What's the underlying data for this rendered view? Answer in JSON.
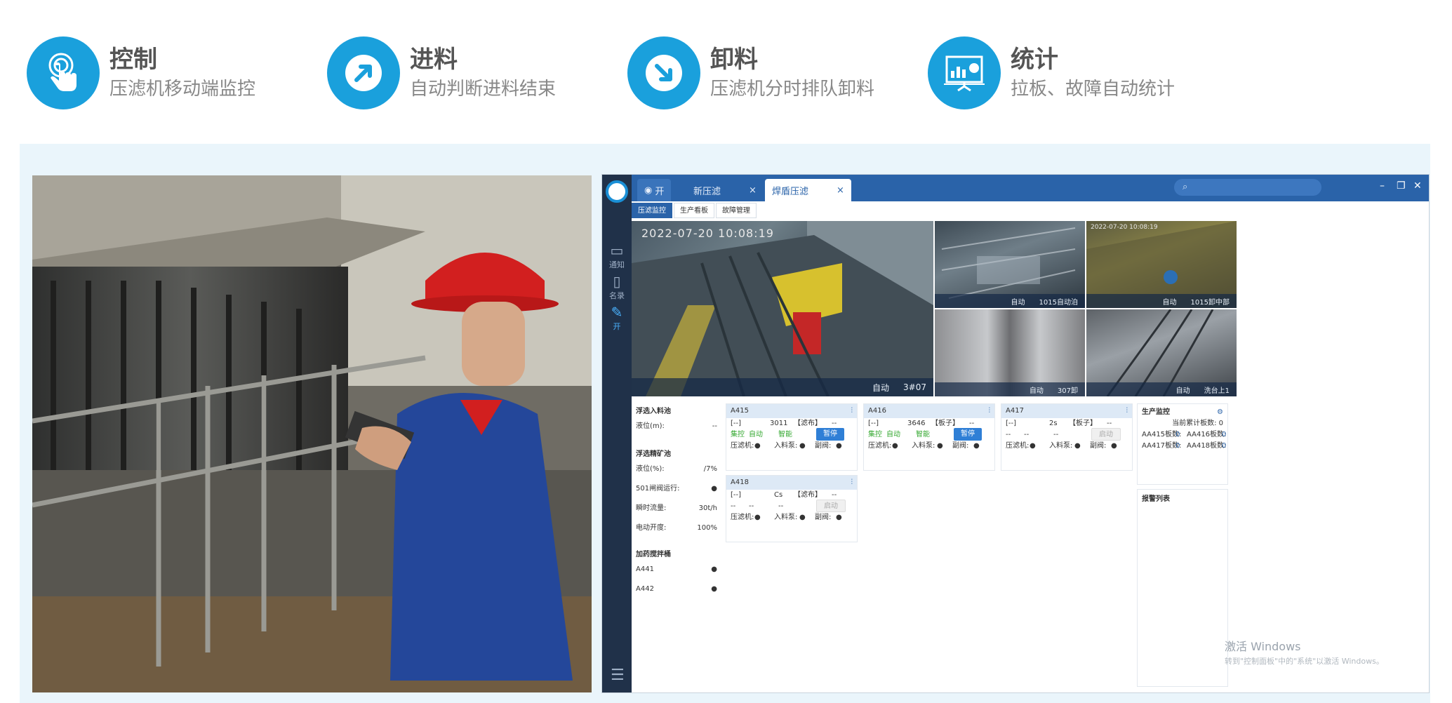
{
  "features": [
    {
      "icon": "tap-hand-icon",
      "title": "控制",
      "subtitle": "压滤机移动端监控"
    },
    {
      "icon": "arrow-up-right-icon",
      "title": "进料",
      "subtitle": "自动判断进料结束"
    },
    {
      "icon": "arrow-down-right-icon",
      "title": "卸料",
      "subtitle": "压滤机分时排队卸料"
    },
    {
      "icon": "presentation-chart-icon",
      "title": "统计",
      "subtitle": "拉板、故障自动统计"
    }
  ],
  "app": {
    "tabs": [
      {
        "label": "开",
        "closable": false
      },
      {
        "label": "新压滤",
        "closable": true
      },
      {
        "label": "焊盾压滤",
        "closable": true,
        "active": true
      }
    ],
    "close_symbol": "×",
    "window_controls": [
      "–",
      "❐",
      "✕"
    ],
    "sidebar": [
      {
        "icon": "chat-icon",
        "label": "通知"
      },
      {
        "icon": "phone-icon",
        "label": "名录"
      },
      {
        "icon": "wrench-icon",
        "label": "开",
        "active": true
      }
    ],
    "subtabs": [
      "压滤监控",
      "生产看板",
      "故障管理"
    ],
    "videos": {
      "main": {
        "timestamp": "2022-07-20 10:08:19",
        "status": "自动",
        "tag": "3#07"
      },
      "cam2": {
        "status": "自动",
        "tag": "1015自动泊"
      },
      "cam3": {
        "timestamp": "2022-07-20 10:08:19",
        "status": "自动",
        "tag": "1015卸中部"
      },
      "cam4": {
        "status": "自动",
        "tag": "307卸"
      },
      "cam5": {
        "status": "自动",
        "tag": "洗台上1"
      }
    },
    "left_panel": {
      "section1_title": "浮选入料池",
      "section1_rows": [
        {
          "label": "液位(m):",
          "value": "--"
        }
      ],
      "section2_title": "浮选精矿池",
      "section2_rows": [
        {
          "label": "液位(%):",
          "value": "/7%"
        },
        {
          "label": "501闸阀运行:",
          "value": "●"
        },
        {
          "label": "瞬时流量:",
          "value": "30t/h"
        },
        {
          "label": "电动开度:",
          "value": "100%"
        }
      ],
      "section3_title": "加药搅拌桶",
      "section3_rows": [
        {
          "label": "A441",
          "value": "●"
        },
        {
          "label": "A442",
          "value": "●"
        }
      ]
    },
    "cards": [
      {
        "id": "A415",
        "code": "3011",
        "bracket": "[--]",
        "tag": "【滤布】",
        "tag_val": "--",
        "mode_a": "集控",
        "mode_b": "自动",
        "mode_c": "智能",
        "button": "暂停",
        "button_state": "active",
        "f1": "压滤机:",
        "f1v": "●",
        "f2": "入料泵:",
        "f2v": "●",
        "f3": "副阀:",
        "f3v": "●"
      },
      {
        "id": "A416",
        "code": "3646",
        "bracket": "[--]",
        "tag": "【板子】",
        "tag_val": "--",
        "mode_a": "集控",
        "mode_b": "自动",
        "mode_c": "智能",
        "button": "暂停",
        "button_state": "active",
        "f1": "压滤机:",
        "f1v": "●",
        "f2": "入料泵:",
        "f2v": "●",
        "f3": "副阀:",
        "f3v": "●"
      },
      {
        "id": "A417",
        "code": "2s",
        "bracket": "[--]",
        "tag": "【板子】",
        "tag_val": "--",
        "mode_a": "--",
        "mode_b": "--",
        "mode_c": "--",
        "button": "启动",
        "button_state": "disabled",
        "f1": "压滤机:",
        "f1v": "●",
        "f2": "入料泵:",
        "f2v": "●",
        "f3": "副阀:",
        "f3v": "●"
      },
      {
        "id": "A418",
        "code": "Cs",
        "bracket": "[--]",
        "tag": "【滤布】",
        "tag_val": "--",
        "mode_a": "--",
        "mode_b": "--",
        "mode_c": "--",
        "button": "启动",
        "button_state": "disabled",
        "f1": "压滤机:",
        "f1v": "●",
        "f2": "入料泵:",
        "f2v": "●",
        "f3": "副阀:",
        "f3v": "●"
      }
    ],
    "monitor": {
      "title": "生产监控",
      "row0": "当前累计板数:  0",
      "rows": [
        {
          "a": "AA415板数:",
          "av": "0",
          "b": "AA416板数:",
          "bv": "0"
        },
        {
          "a": "AA417板数:",
          "av": "0",
          "b": "AA418板数:",
          "bv": "0"
        }
      ],
      "alarm_title": "报警列表"
    },
    "activation_line1": "激活 Windows",
    "activation_line2": "转到\"控制面板\"中的\"系统\"以激活 Windows。"
  }
}
